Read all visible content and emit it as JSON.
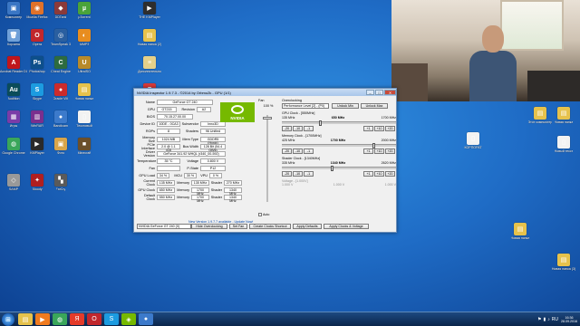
{
  "desktop_icons": [
    {
      "id": "komputer",
      "label": "Компьютер",
      "color": "#3a76c4",
      "glyph": "▣"
    },
    {
      "id": "firefox",
      "label": "Mozilla Firefox",
      "color": "#e0722a",
      "glyph": "◉"
    },
    {
      "id": "ddtank",
      "label": "DDTank",
      "color": "#8b3a3a",
      "glyph": "◆"
    },
    {
      "id": "utorrent",
      "label": "µTorrent",
      "color": "#4aa33a",
      "glyph": "µ"
    },
    {
      "id": "bfmplayer",
      "label": "THE KMPlayer",
      "color": "#2e2e2e",
      "glyph": "▶"
    },
    {
      "id": "trash",
      "label": "Корзина",
      "color": "#6fa0d8",
      "glyph": "🗑"
    },
    {
      "id": "opera",
      "label": "Opera",
      "color": "#c1272d",
      "glyph": "O"
    },
    {
      "id": "teamspeak",
      "label": "TeamSpeak 3",
      "color": "#2a5fa0",
      "glyph": "◎"
    },
    {
      "id": "aimp",
      "label": "AIMP3",
      "color": "#e88d1f",
      "glyph": "◐"
    },
    {
      "id": "newfolder1",
      "label": "Новая папка (2)",
      "color": "#e6c24c",
      "glyph": "▤"
    },
    {
      "id": "acrobat",
      "label": "Acrobat Reader DC",
      "color": "#c0161b",
      "glyph": "A"
    },
    {
      "id": "photoshop",
      "label": "Photoshop",
      "color": "#0d4f8b",
      "glyph": "Ps"
    },
    {
      "id": "cheatengine",
      "label": "Cheat Engine",
      "color": "#2d6b3f",
      "glyph": "C"
    },
    {
      "id": "ultraiso",
      "label": "UltraISO",
      "color": "#b88a2a",
      "glyph": "U"
    },
    {
      "id": "daemon",
      "label": "Дополнительно",
      "color": "#e5d08a",
      "glyph": "≡"
    },
    {
      "id": "audition",
      "label": "Audition",
      "color": "#0a4c5a",
      "glyph": "Au"
    },
    {
      "id": "skype",
      "label": "Skype",
      "color": "#1c9be0",
      "glyph": "S"
    },
    {
      "id": "oracle",
      "label": "Oracle VM",
      "color": "#cc2b2b",
      "glyph": "●"
    },
    {
      "id": "folder2",
      "label": "Новая папка",
      "color": "#e6c24c",
      "glyph": "▤"
    },
    {
      "id": "fraps",
      "label": "Fraps",
      "color": "#d73a3a",
      "glyph": "F"
    },
    {
      "id": "mgames",
      "label": "Игры",
      "color": "#7a3ca8",
      "glyph": "▦"
    },
    {
      "id": "winrar",
      "label": "WinRAR",
      "color": "#7a2f8e",
      "glyph": "▥"
    },
    {
      "id": "bandicam",
      "label": "Bandicam",
      "color": "#3c7acb",
      "glyph": "●"
    },
    {
      "id": "txt1",
      "label": "Текстовый",
      "color": "#f2f2f2",
      "glyph": "▯"
    },
    {
      "id": "yandex",
      "label": "Яндекс",
      "color": "#e43b2a",
      "glyph": "Я"
    },
    {
      "id": "chrome",
      "label": "Google Chrome",
      "color": "#3aa65a",
      "glyph": "◍"
    },
    {
      "id": "kmplayer2",
      "label": "KMPlayer",
      "color": "#2a2a2a",
      "glyph": "▶"
    },
    {
      "id": "photo",
      "label": "Фото",
      "color": "#d9a54a",
      "glyph": "▣"
    },
    {
      "id": "minecraft",
      "label": "Minecraft",
      "color": "#6b4f2a",
      "glyph": "■"
    },
    {
      "id": "camtasia",
      "label": "Camtasia",
      "color": "#3f8d3f",
      "glyph": "C"
    },
    {
      "id": "sam",
      "label": "SAMP",
      "color": "#999999",
      "glyph": "◇"
    },
    {
      "id": "mouse",
      "label": "Bloody",
      "color": "#b01f1f",
      "glyph": "✦"
    },
    {
      "id": "game1",
      "label": "FarCry",
      "color": "#5a5a5a",
      "glyph": "▚"
    }
  ],
  "webcam": {
    "caption": ""
  },
  "nv_window": {
    "title": "NVIDIA Inspector 1.9.7.3 - ©2014 by Orbmu2k - GPU (1/1)",
    "title_buttons": {
      "minimize": "–",
      "maximize": "□",
      "close": "✕"
    },
    "logo_text": "NVIDIA",
    "fields": {
      "name_label": "Name",
      "name": "GeForce GT 240",
      "gpu_label": "GPU",
      "gpu": "GT215",
      "revision_label": "Revision",
      "revision": "A2",
      "bios_label": "BIOS",
      "bios": "70.15.27.00.00",
      "device_label": "Device ID",
      "device": "10DE - 0CA3",
      "subvendor_label": "Subvendor",
      "subvendor": "Inno3D",
      "rops_label": "ROPs",
      "rops": "8",
      "shaders_label": "Shaders",
      "shaders": "96 Unified",
      "memsize_label": "Memory Size",
      "memsize": "1024 MB",
      "memtype_label": "Mem Type",
      "memtype": "GDDR5 (Hynix)",
      "pcie_label": "PCIe Interface",
      "pcie": "2.0 @ 1.1 x16",
      "bus_label": "Bus Width",
      "bus": "128 Bit (54.4 GB/s)",
      "driver_label": "Driver Version",
      "driver": "GeForce 341.92 WHQL (r340_00-592)",
      "temp_label": "Temperature",
      "temp": "35 °C",
      "voltage_label": "Voltage",
      "voltage": "0.800 V",
      "fan_label": "Fan",
      "fan_val": "",
      "pstate_label": "P-State",
      "pstate": "P12",
      "load_label": "GPU Load",
      "load": "34 %",
      "mcu_label": "MCU",
      "mcu": "30 %",
      "vpu_label": "VPU",
      "vpu": "0 %",
      "curclk_label": "Current Clock",
      "curclk_gpu": "135 MHz",
      "curclk_mem_label": "Memory",
      "curclk_mem": "135 MHz",
      "curclk_sh_label": "Shader",
      "curclk_sh": "270 MHz",
      "gpuclk_label": "GPU Clock",
      "gpuclk_gpu": "650 MHz",
      "gpuclk_mem_label": "Memory",
      "gpuclk_mem": "1700 MHz",
      "gpuclk_sh_label": "Shader",
      "gpuclk_sh": "1340 MHz",
      "defclk_label": "Default Clock",
      "defclk_gpu": "550 MHz",
      "defclk_mem_label": "Memory",
      "defclk_mem": "1700 MHz",
      "defclk_sh_label": "Shader",
      "defclk_sh": "1340 MHz"
    },
    "update_tip": "New Version 1.9.7.7 available - Update Now!",
    "fan": {
      "label": "Fan",
      "value": "100 %",
      "auto_label": "Auto",
      "level": 0.98
    },
    "overclocking": {
      "header": "Overclocking",
      "perf_level": "Performance Level [2] - (P0)",
      "unlock_min": "Unlock Min",
      "unlock_max": "Unlock Max",
      "gpu": {
        "label": "GPU Clock - [550MHz]",
        "min": "135 MHz",
        "value": "650 MHz",
        "max": "1700 MHz",
        "level": 0.34
      },
      "mem": {
        "label": "Memory Clock - [1700MHz]",
        "min": "425 MHz",
        "value": "1700 MHz",
        "max": "2000 MHz",
        "level": 0.82
      },
      "shader": {
        "label": "Shader Clock - [1340MHz]",
        "min": "335 MHz",
        "value": "1340 MHz",
        "max": "2620 MHz",
        "level": 0.44
      },
      "volt": {
        "label": "Voltage - [1.000V]",
        "min": "1.000 V",
        "value": "1.000 V",
        "max": "1.000 V"
      },
      "step_buttons": [
        "-20",
        "-10",
        "-1",
        "+1",
        "+10",
        "+20"
      ]
    },
    "bottom": {
      "gpu_select": "NVIDIA GeForce GT 240 (0)",
      "hide_oc": "Hide Overclocking",
      "set_fan": "Set Fan",
      "create_shortcut": "Create Clocks Shortcut",
      "apply_defaults": "Apply Defaults",
      "apply_clocks": "Apply Clocks & Voltage"
    }
  },
  "right_icons": [
    {
      "id": "r1",
      "label": "Этот компьютер",
      "color": "#e6c24c",
      "glyph": "▤"
    },
    {
      "id": "r2",
      "label": "Новая папка",
      "color": "#e6c24c",
      "glyph": "▤"
    },
    {
      "id": "r3",
      "label": "КОРПОРАТ",
      "color": "#f2f2f2",
      "glyph": "▯"
    },
    {
      "id": "r4",
      "label": "Новый текст",
      "color": "#f2f2f2",
      "glyph": "▯"
    },
    {
      "id": "r5",
      "label": "Новая папка",
      "color": "#e6c24c",
      "glyph": "▤"
    },
    {
      "id": "r6",
      "label": "Новая папка (3)",
      "color": "#e6c24c",
      "glyph": "▤"
    }
  ],
  "taskbar": {
    "items": [
      {
        "id": "explorer",
        "color": "#e6c24c",
        "glyph": "▤"
      },
      {
        "id": "wmp",
        "color": "#f07b1f",
        "glyph": "▶"
      },
      {
        "id": "chrome",
        "color": "#3aa65a",
        "glyph": "◍"
      },
      {
        "id": "yandex",
        "color": "#e43b2a",
        "glyph": "Я"
      },
      {
        "id": "opera",
        "color": "#c1272d",
        "glyph": "O"
      },
      {
        "id": "skype",
        "color": "#1c9be0",
        "glyph": "S"
      },
      {
        "id": "nvinspector",
        "color": "#76b900",
        "glyph": "◈"
      },
      {
        "id": "bandicam",
        "color": "#3c7acb",
        "glyph": "●"
      }
    ],
    "lang": "RU",
    "time": "16:36",
    "date": "28.09.2016"
  }
}
